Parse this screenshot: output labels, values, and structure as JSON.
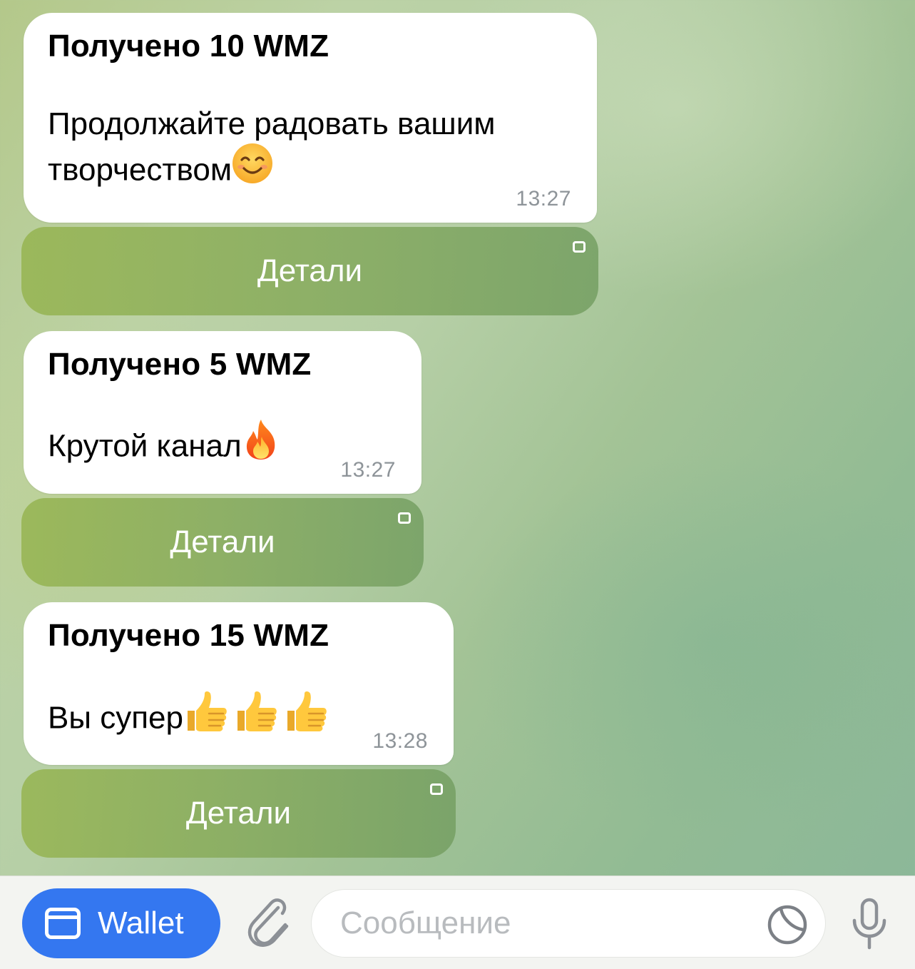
{
  "messages": [
    {
      "title": "Получено 10 WMZ",
      "text": "Продолжайте радовать вашим творчеством",
      "emoji": "smiling-face",
      "time": "13:27",
      "button": "Детали"
    },
    {
      "title": "Получено 5 WMZ",
      "text": "Крутой канал",
      "emoji": "fire",
      "time": "13:27",
      "button": "Детали"
    },
    {
      "title": "Получено 15 WMZ",
      "text": "Вы супер",
      "emoji": "thumbs-up x3",
      "time": "13:28",
      "button": "Детали"
    }
  ],
  "input_bar": {
    "wallet_label": "Wallet",
    "placeholder": "Сообщение",
    "accent": "#3477f0"
  }
}
